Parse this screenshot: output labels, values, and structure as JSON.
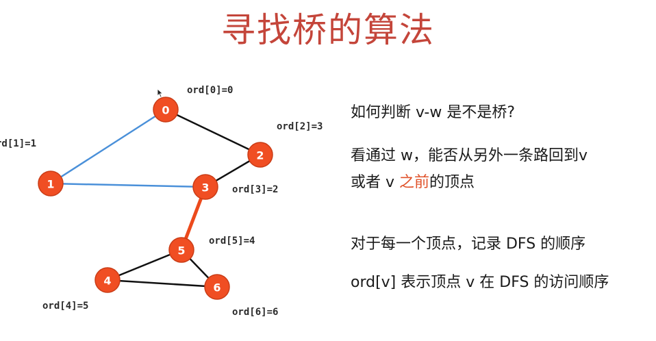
{
  "title": "寻找桥的算法",
  "colors": {
    "title": "#c4453a",
    "node_fill": "#f04e23",
    "edge_default": "#111111",
    "edge_visited": "#4a90d9",
    "edge_bridge": "#ec4a1c",
    "accent_text": "#e0522a"
  },
  "graph": {
    "nodes": [
      {
        "id": "0",
        "label": "0",
        "ord": "ord[0]=0"
      },
      {
        "id": "1",
        "label": "1",
        "ord": "rd[1]=1"
      },
      {
        "id": "2",
        "label": "2",
        "ord": "ord[2]=3"
      },
      {
        "id": "3",
        "label": "3",
        "ord": "ord[3]=2"
      },
      {
        "id": "4",
        "label": "4",
        "ord": "ord[4]=5"
      },
      {
        "id": "5",
        "label": "5",
        "ord": "ord[5]=4"
      },
      {
        "id": "6",
        "label": "6",
        "ord": "ord[6]=6"
      }
    ],
    "edges": [
      {
        "from": "0",
        "to": "1",
        "style": "visited"
      },
      {
        "from": "1",
        "to": "3",
        "style": "visited"
      },
      {
        "from": "0",
        "to": "2",
        "style": "default"
      },
      {
        "from": "2",
        "to": "3",
        "style": "default"
      },
      {
        "from": "3",
        "to": "5",
        "style": "bridge"
      },
      {
        "from": "5",
        "to": "4",
        "style": "default"
      },
      {
        "from": "5",
        "to": "6",
        "style": "default"
      },
      {
        "from": "4",
        "to": "6",
        "style": "default"
      }
    ]
  },
  "text": {
    "question": "如何判断 v-w 是不是桥?",
    "explain_line1": "看通过 w，能否从另外一条路回到v",
    "explain_line2_a": "或者 v ",
    "explain_line2_accent": "之前",
    "explain_line2_b": "的顶点",
    "record": "对于每一个顶点，记录 DFS 的顺序",
    "ord_desc": "ord[v] 表示顶点 v 在 DFS 的访问顺序"
  }
}
